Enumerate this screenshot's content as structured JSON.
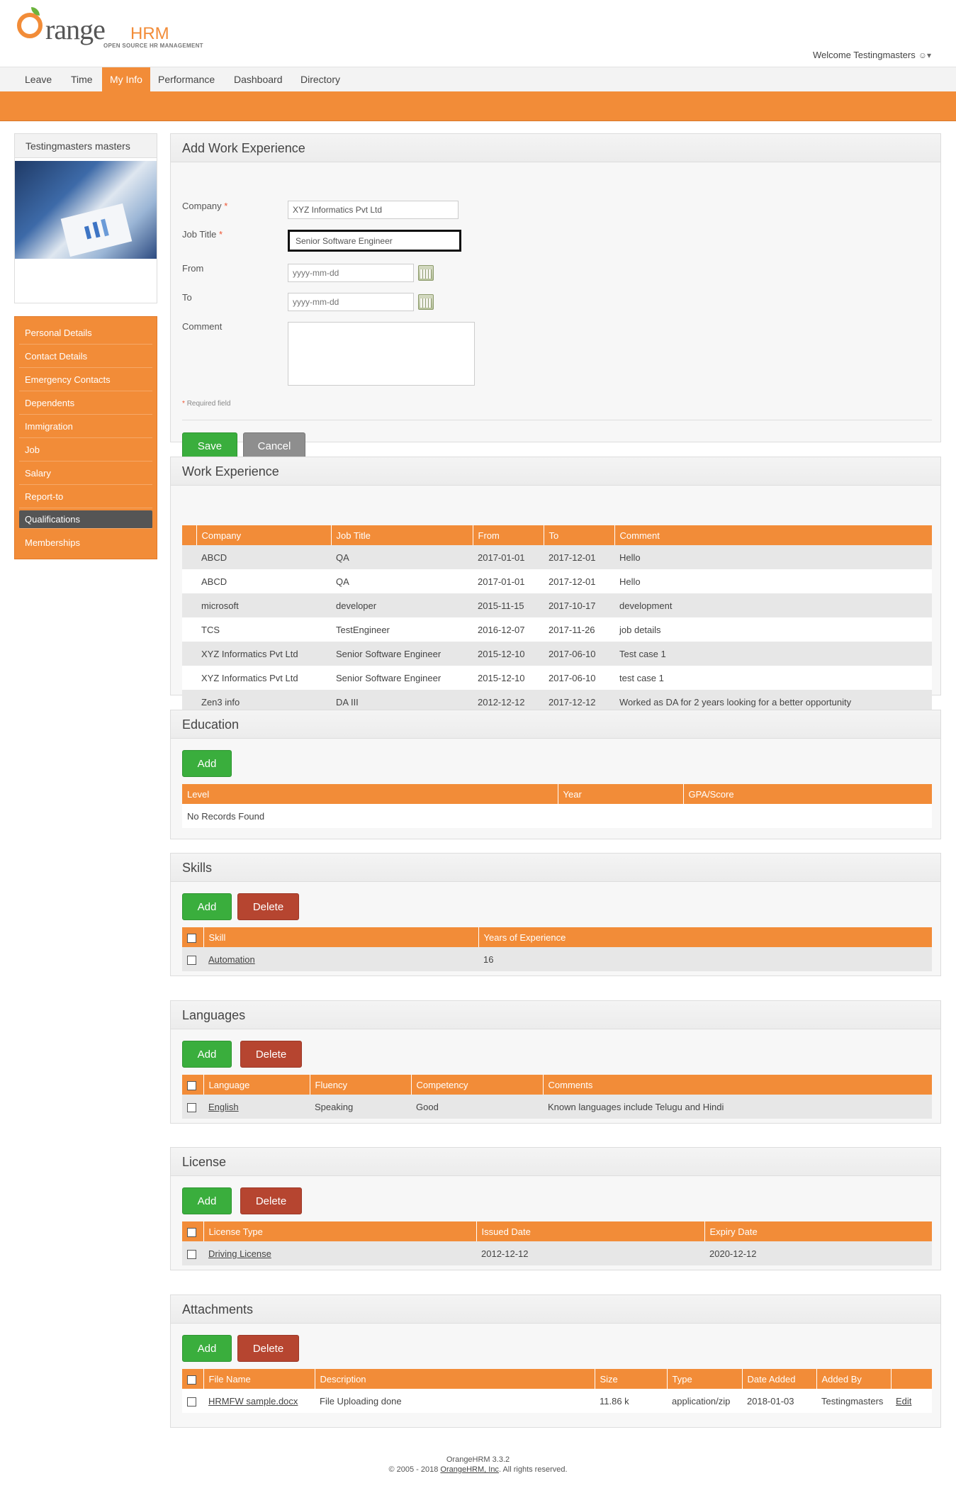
{
  "header": {
    "logo_word": "range",
    "logo_brand": "HRM",
    "logo_tagline": "OPEN SOURCE HR MANAGEMENT",
    "welcome": "Welcome Testingmasters",
    "welcome_icon": "user-icon"
  },
  "menu": {
    "items": [
      "Leave",
      "Time",
      "My Info",
      "Performance",
      "Dashboard",
      "Directory"
    ],
    "active": "My Info"
  },
  "profile": {
    "name": "Testingmasters masters"
  },
  "sidemenu": {
    "items": [
      "Personal Details",
      "Contact Details",
      "Emergency Contacts",
      "Dependents",
      "Immigration",
      "Job",
      "Salary",
      "Report-to",
      "Qualifications",
      "Memberships"
    ],
    "active": "Qualifications"
  },
  "add_work": {
    "title": "Add Work Experience",
    "company_label": "Company",
    "job_title_label": "Job Title",
    "from_label": "From",
    "to_label": "To",
    "comment_label": "Comment",
    "company_value": "XYZ Informatics Pvt Ltd",
    "job_title_value": "Senior Software Engineer",
    "from_placeholder": "yyyy-mm-dd",
    "to_placeholder": "yyyy-mm-dd",
    "required_note": "Required field",
    "save": "Save",
    "cancel": "Cancel"
  },
  "work": {
    "title": "Work Experience",
    "headers": [
      "Company",
      "Job Title",
      "From",
      "To",
      "Comment"
    ],
    "rows": [
      [
        "ABCD",
        "QA",
        "2017-01-01",
        "2017-12-01",
        "Hello"
      ],
      [
        "ABCD",
        "QA",
        "2017-01-01",
        "2017-12-01",
        "Hello"
      ],
      [
        "microsoft",
        "developer",
        "2015-11-15",
        "2017-10-17",
        "development"
      ],
      [
        "TCS",
        "TestEngineer",
        "2016-12-07",
        "2017-11-26",
        "job details"
      ],
      [
        "XYZ Informatics Pvt Ltd",
        "Senior Software Engineer",
        "2015-12-10",
        "2017-06-10",
        "Test case 1"
      ],
      [
        "XYZ Informatics Pvt Ltd",
        "Senior Software Engineer",
        "2015-12-10",
        "2017-06-10",
        "test case 1"
      ],
      [
        "Zen3 info",
        "DA III",
        "2012-12-12",
        "2017-12-12",
        "Worked as DA for 2 years looking for a better opportunity"
      ]
    ]
  },
  "education": {
    "title": "Education",
    "add": "Add",
    "headers": [
      "Level",
      "Year",
      "GPA/Score"
    ],
    "empty": "No Records Found"
  },
  "skills": {
    "title": "Skills",
    "add": "Add",
    "delete": "Delete",
    "headers": [
      "Skill",
      "Years of Experience"
    ],
    "rows": [
      [
        "Automation",
        "16"
      ]
    ]
  },
  "languages": {
    "title": "Languages",
    "add": "Add",
    "delete": "Delete",
    "headers": [
      "Language",
      "Fluency",
      "Competency",
      "Comments"
    ],
    "rows": [
      [
        "English",
        "Speaking",
        "Good",
        "Known languages include Telugu and Hindi"
      ]
    ]
  },
  "license": {
    "title": "License",
    "add": "Add",
    "delete": "Delete",
    "headers": [
      "License Type",
      "Issued Date",
      "Expiry Date"
    ],
    "rows": [
      [
        "Driving License",
        "2012-12-12",
        "2020-12-12"
      ]
    ]
  },
  "attachments": {
    "title": "Attachments",
    "add": "Add",
    "delete": "Delete",
    "headers": [
      "File Name",
      "Description",
      "Size",
      "Type",
      "Date Added",
      "Added By",
      ""
    ],
    "rows": [
      [
        "HRMFW sample.docx",
        "File Uploading done",
        "11.86 k",
        "application/zip",
        "2018-01-03",
        "Testingmasters",
        "Edit"
      ]
    ]
  },
  "footer": {
    "version": "OrangeHRM 3.3.2",
    "copy_prefix": "© 2005 - 2018",
    "company_link": "OrangeHRM, Inc",
    "copy_suffix": ". All rights reserved."
  },
  "colors": {
    "accent": "#f28c38",
    "green": "#3aae3d",
    "red": "#b64530"
  }
}
